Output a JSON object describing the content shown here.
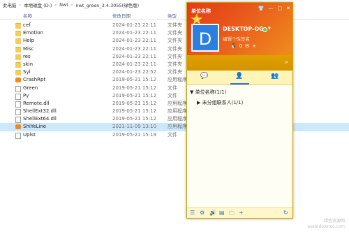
{
  "breadcrumb": {
    "parts": [
      "此电脑",
      "本地磁盘 (D:)",
      "Nwt",
      "nwt_green_3.4.3055(绿色版)"
    ]
  },
  "columns": {
    "name": "名称",
    "date": "修改日期",
    "type": "类型"
  },
  "files": [
    {
      "name": "cef",
      "date": "2024-01-23 22:11",
      "type": "文件夹",
      "kind": "folder"
    },
    {
      "name": "Emotion",
      "date": "2024-01-23 22:11",
      "type": "文件夹",
      "kind": "folder"
    },
    {
      "name": "Help",
      "date": "2024-01-23 22:11",
      "type": "文件夹",
      "kind": "folder"
    },
    {
      "name": "Misc",
      "date": "2024-01-23 22:11",
      "type": "文件夹",
      "kind": "folder"
    },
    {
      "name": "res",
      "date": "2024-01-23 22:11",
      "type": "文件夹",
      "kind": "folder"
    },
    {
      "name": "skin",
      "date": "2024-01-23 22:11",
      "type": "文件夹",
      "kind": "folder"
    },
    {
      "name": "Syl",
      "date": "2024-01-23 22:52",
      "type": "文件夹",
      "kind": "folder"
    },
    {
      "name": "CrashRpt",
      "date": "2019-05-21 15:12",
      "type": "应用程序",
      "kind": "exe-orange"
    },
    {
      "name": "Green",
      "date": "2019-05-21 15:12",
      "type": "文件",
      "kind": "doc"
    },
    {
      "name": "Py",
      "date": "2019-05-21 15:12",
      "type": "文件",
      "kind": "doc"
    },
    {
      "name": "Remote.dll",
      "date": "2019-05-21 15:12",
      "type": "应用程序",
      "kind": "doc"
    },
    {
      "name": "ShellExt32.dll",
      "date": "2019-05-21 15:12",
      "type": "应用程序",
      "kind": "doc"
    },
    {
      "name": "ShellExt64.dll",
      "date": "2019-05-21 15:12",
      "type": "应用程序",
      "kind": "doc"
    },
    {
      "name": "ShiYeLine",
      "date": "2021-11-09 13:10",
      "type": "应用程序",
      "kind": "exe-orange",
      "selected": true
    },
    {
      "name": "Uplst",
      "date": "2019-05-21 15:19",
      "type": "文件",
      "kind": "doc"
    }
  ],
  "client": {
    "title": "单位名称",
    "window_buttons": [
      "👕",
      "—",
      "□",
      "✕"
    ],
    "avatar_letter": "D",
    "username": "DESKTOP-OG",
    "signature": "编辑个性签名",
    "head_icons": [
      "🐧",
      "0",
      "✉",
      "+"
    ],
    "tabs": [
      "💬",
      "👤",
      "👥"
    ],
    "groups": [
      {
        "arrow": "▼",
        "label": "单位名称(1/1)"
      },
      {
        "arrow": "▶",
        "label": "未分组联系人(1/1)"
      }
    ],
    "bottom_icons": [
      "☰",
      "⚙",
      "🔊",
      "▤",
      "🗀",
      "+",
      "↻"
    ]
  },
  "watermark": {
    "line1": "绿色资源网",
    "line2": "www.downcc.com"
  },
  "colors": {
    "head_gradient_start": "#e63a16",
    "head_gradient_end": "#f08d1e",
    "search_bar": "#d29400",
    "accent_blue": "#2f74c9",
    "selected_row": "#cce8ff"
  }
}
